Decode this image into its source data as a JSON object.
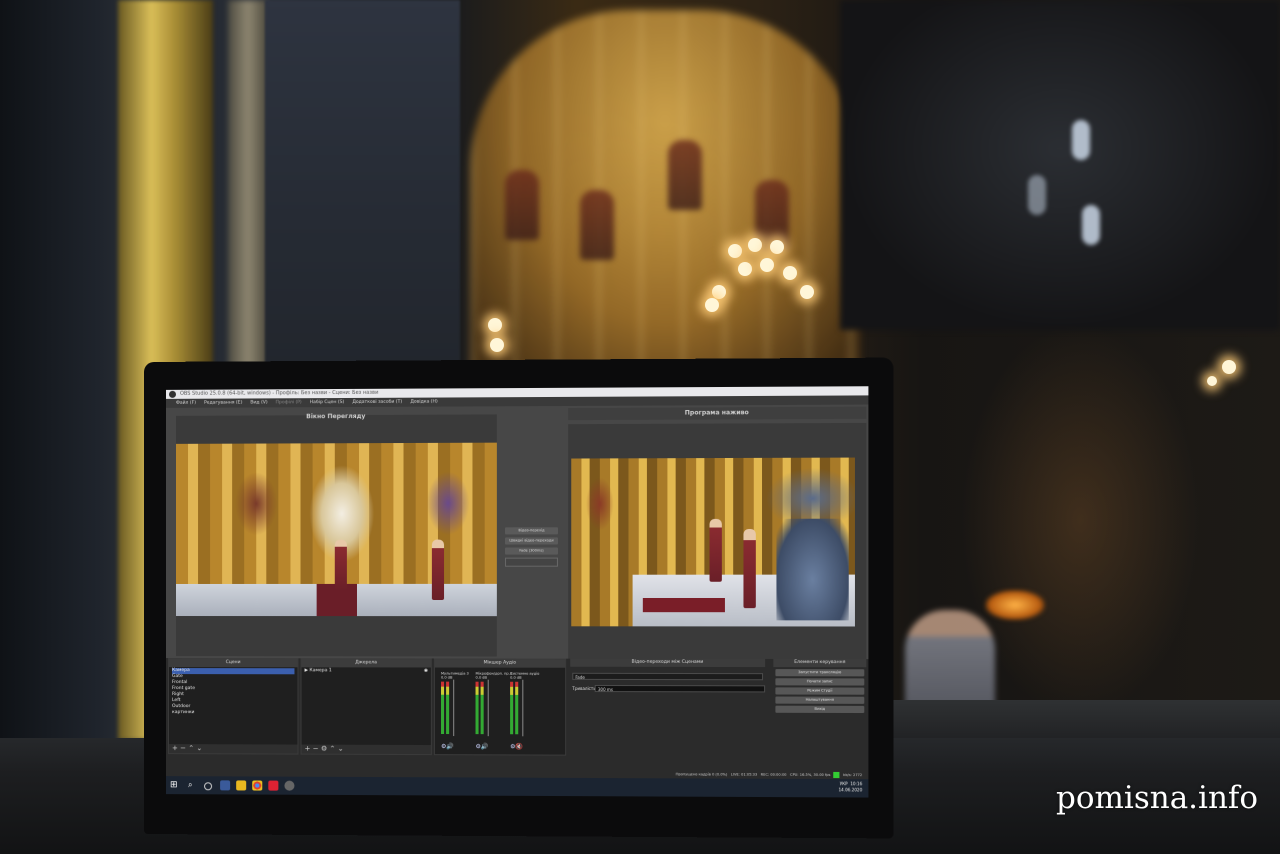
{
  "watermark": "pomisna.info",
  "obs": {
    "title": "OBS Studio 25.0.8 (64-bit, windows) - Профіль: Без назви - Сцени: Без назви",
    "menu": [
      "Файл (F)",
      "Редагування (E)",
      "Вид (V)",
      "Профілі (P)",
      "Набір Сцен (S)",
      "Додаткові засоби (T)",
      "Довідка (H)"
    ],
    "preview_label": "Вікно Перегляду",
    "program_label": "Програма наживо",
    "transition_buttons": [
      "Відео-перехід",
      "Швидкі відео-переходи",
      "Fade (300ms)"
    ],
    "docks": {
      "scenes": {
        "title": "Сцени",
        "items": [
          "Камера",
          "Gate",
          "Frontal",
          "Front gate",
          "Right",
          "Left",
          "Outdoor",
          "картинки"
        ],
        "selected": 0
      },
      "sources": {
        "title": "Джерела",
        "items": [
          "Камера 1"
        ]
      },
      "mixer": {
        "title": "Мікшер Аудіо",
        "channels": [
          {
            "name": "Мультимедіа 3",
            "level": "0.0 dB",
            "muted": false
          },
          {
            "name": "Мікрофон/доп. пр.3",
            "level": "0.0 dB",
            "muted": false
          },
          {
            "name": "Системне аудіо",
            "level": "0.0 dB",
            "muted": true
          }
        ]
      },
      "transitions": {
        "title": "Відео-переходи між Сценами",
        "current": "Fade",
        "duration_label": "Тривалість",
        "duration_value": "300 ms"
      },
      "controls": {
        "title": "Елементи керування",
        "buttons": [
          "Запустити трансляцію",
          "Почати запис",
          "Режим Студії",
          "Налаштування",
          "Вихід"
        ]
      }
    },
    "status": {
      "dropped": "Пропущено кадрів 0 (0.0%)",
      "live": "LIVE: 01:05:33",
      "rec": "REC: 00:00:00",
      "cpu": "CPU: 16.5%, 30.00 fps",
      "kbps": "kb/s: 2772"
    },
    "taskbar": {
      "lang": "УКР",
      "time": "10:16",
      "date": "14.06.2020"
    }
  }
}
